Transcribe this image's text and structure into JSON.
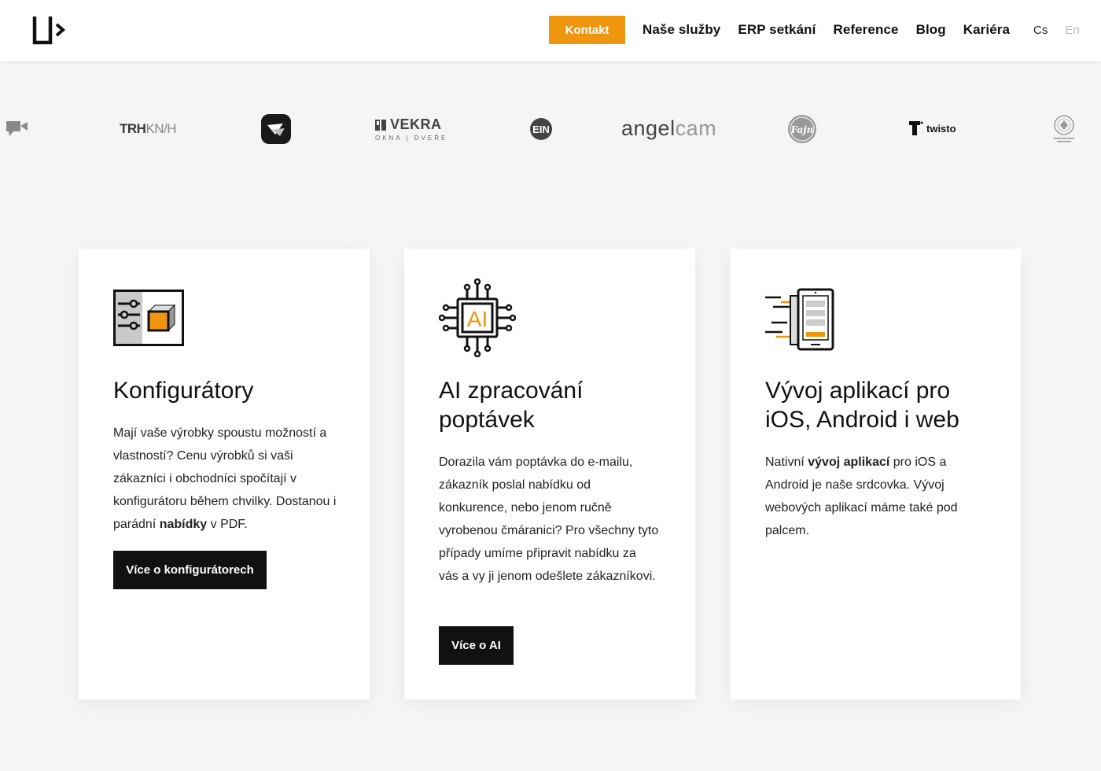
{
  "header": {
    "logo_icon": "brand-logo-icon",
    "cta_label": "Kontakt",
    "cta_color": "#f0960e",
    "nav": [
      "Naše služby",
      "ERP setkání",
      "Reference",
      "Blog",
      "Kariéra"
    ],
    "lang_cs": "Cs",
    "lang_en": "En"
  },
  "clients": {
    "trhknih_a": "TRH",
    "trhknih_b": "KN/H",
    "vekra": "VEKRA",
    "vekra_sub": "OKNA | DVEŘE",
    "ein": "EIN",
    "angelcam_a": "angel",
    "angelcam_b": "cam",
    "fajn": "Fajn",
    "twisto": "twisto"
  },
  "cards": [
    {
      "icon": "configurator-icon",
      "title": "Konfigurátory",
      "text_1": "Mají vaše výrobky spoustu možností a vlastností? Cenu výrobků si vaši zákazníci i obchodníci spočítají v konfigurátoru během chvilky. Dostanou i parádní ",
      "text_bold": "nabídky",
      "text_2": " v PDF.",
      "button": "Více o konfigurátorech"
    },
    {
      "icon": "ai-chip-icon",
      "icon_label": "AI",
      "title": "AI zpracování poptávek",
      "text": "Dorazila vám poptávka do e-mailu, zákazník poslal nabídku od konkurence, nebo jenom ručně vyrobenou čmáranici? Pro všechny tyto případy umíme připravit nabídku za vás a vy ji jenom odešlete zákazníkovi.",
      "button": "Více o AI"
    },
    {
      "icon": "mobile-app-icon",
      "title": "Vývoj aplikací pro iOS, Android i web",
      "text_1": "Nativní ",
      "text_bold": "vývoj aplikací",
      "text_2": " pro iOS a Android je naše srdcovka. Vývoj webových aplikací máme také pod palcem."
    }
  ]
}
